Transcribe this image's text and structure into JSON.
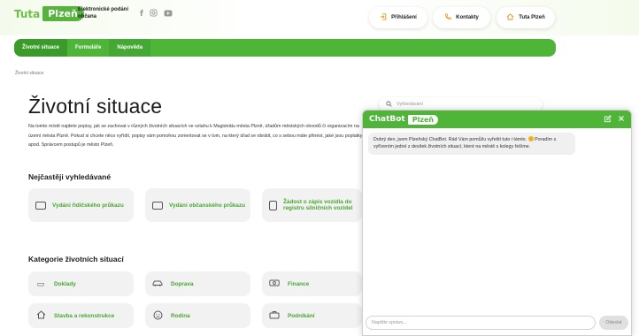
{
  "header": {
    "logo_tuta": "Tuta",
    "logo_plzen": "Plzeň",
    "logo_subtitle": "Elektronické podání občana",
    "socials": [
      "facebook-icon",
      "instagram-icon",
      "youtube-icon"
    ],
    "buttons": {
      "login": "Přihlášení",
      "contacts": "Kontakty",
      "home": "Tuta Plzeň"
    }
  },
  "nav": {
    "items": [
      "Životní situace",
      "Formuláře",
      "Nápověda"
    ]
  },
  "breadcrumb": "Životní situace",
  "main": {
    "title": "Životní situace",
    "intro": "Na tomto místě najdete popisy, jak se zachovat v různých životních situacích ve vztahu k Magistrátu města Plzně, úřadům městských obvodů či organizacím na území města Plzně. Pokud si chcete něco vyřídit, popisy vám pomohou zorientovat se v tom, na který úřad se obrátit, co s sebou máte přinést, jaké jsou poplatky apod. Správcem postupů je město Plzeň.",
    "search_placeholder": "Vyhledávání",
    "frequent_title": "Nejčastěji vyhledávané",
    "frequent": [
      {
        "label": "Vydání řidičského průkazu",
        "icon": "driving-license-icon"
      },
      {
        "label": "Vydání občanského průkazu",
        "icon": "id-card-icon"
      },
      {
        "label": "Žádost o zápis vozidla do registru silničních vozidel",
        "icon": "document-icon"
      }
    ],
    "categories_title": "Kategorie životních situací",
    "categories": [
      {
        "label": "Doklady",
        "icon": "id-card-icon"
      },
      {
        "label": "Doprava",
        "icon": "car-icon"
      },
      {
        "label": "Finance",
        "icon": "money-icon"
      },
      {
        "label": "Stavba a rekonstrukce",
        "icon": "house-icon"
      },
      {
        "label": "Rodina",
        "icon": "family-icon"
      },
      {
        "label": "Podnikání",
        "icon": "briefcase-icon"
      }
    ]
  },
  "chatbot": {
    "title": "ChatBot",
    "title_badge": "Plzeň",
    "message": "Dobrý den, jsem Plzeňský ChatBot. Rád Vám pomůžu vyřešit tuto i támto.",
    "message_cont": "Poradím s vyřízením jedné z desítek životních situací, které na městě s kolegy řešíme.",
    "input_placeholder": "Napište zprávu...",
    "send_label": "Odeslat"
  },
  "colors": {
    "brand_green": "#4fb539",
    "accent_orange": "#e59b1c",
    "card_bg": "#f2f2f2"
  }
}
